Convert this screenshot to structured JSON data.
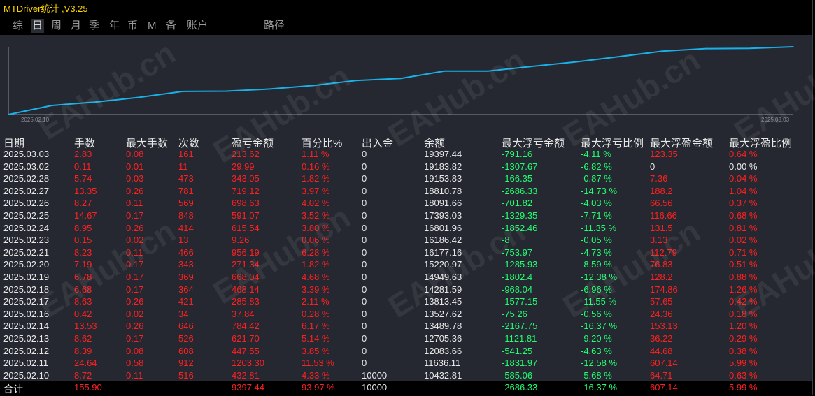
{
  "title": "MTDriver统计 ,V3.25",
  "tabs": [
    {
      "label": "综",
      "active": false
    },
    {
      "label": "日",
      "active": true
    },
    {
      "label": "周",
      "active": false
    },
    {
      "label": "月",
      "active": false
    },
    {
      "label": "季",
      "active": false
    },
    {
      "label": "年",
      "active": false
    },
    {
      "label": "币",
      "active": false
    },
    {
      "label": "M",
      "active": false
    },
    {
      "label": "备",
      "active": false
    },
    {
      "label": "账户",
      "active": false
    },
    {
      "label": "路径",
      "active": false
    }
  ],
  "watermark": "EAHub.cn",
  "chart_data": {
    "type": "line",
    "x_start_label": "2025.02.10",
    "x_end_label": "2025.03.03",
    "x": [
      "2025.02.10",
      "2025.02.11",
      "2025.02.12",
      "2025.02.13",
      "2025.02.14",
      "2025.02.16",
      "2025.02.17",
      "2025.02.18",
      "2025.02.19",
      "2025.02.20",
      "2025.02.21",
      "2025.02.23",
      "2025.02.24",
      "2025.02.25",
      "2025.02.26",
      "2025.02.27",
      "2025.02.28",
      "2025.03.02",
      "2025.03.03"
    ],
    "values": [
      10432.81,
      11636.11,
      12083.66,
      12705.36,
      13489.78,
      13527.62,
      13813.45,
      14281.59,
      14949.63,
      15220.97,
      16177.16,
      16186.42,
      16801.96,
      17393.03,
      18091.66,
      18810.78,
      19153.83,
      19183.82,
      19397.44
    ],
    "line_color": "#1ab0e8"
  },
  "table": {
    "headers": [
      "日期",
      "手数",
      "最大手数",
      "次数",
      "盈亏金额",
      "百分比%",
      "出入金",
      "余额",
      "最大浮亏金额",
      "最大浮亏比例",
      "最大浮盈金额",
      "最大浮盈比例"
    ],
    "rows": [
      [
        "2025.03.03",
        "2.83",
        "0.08",
        "161",
        "213.62",
        "1.11 %",
        "0",
        "19397.44",
        "-791.16",
        "-4.11 %",
        "123.35",
        "0.64 %"
      ],
      [
        "2025.03.02",
        "0.11",
        "0.01",
        "11",
        "29.99",
        "0.16 %",
        "0",
        "19183.82",
        "-1307.67",
        "-6.82 %",
        "0",
        "0.00 %"
      ],
      [
        "2025.02.28",
        "5.74",
        "0.03",
        "473",
        "343.05",
        "1.82 %",
        "0",
        "19153.83",
        "-166.35",
        "-0.87 %",
        "7.36",
        "0.04 %"
      ],
      [
        "2025.02.27",
        "13.35",
        "0.26",
        "781",
        "719.12",
        "3.97 %",
        "0",
        "18810.78",
        "-2686.33",
        "-14.73 %",
        "188.2",
        "1.04 %"
      ],
      [
        "2025.02.26",
        "8.27",
        "0.11",
        "569",
        "698.63",
        "4.02 %",
        "0",
        "18091.66",
        "-701.82",
        "-4.03 %",
        "66.56",
        "0.37 %"
      ],
      [
        "2025.02.25",
        "14.67",
        "0.17",
        "848",
        "591.07",
        "3.52 %",
        "0",
        "17393.03",
        "-1329.35",
        "-7.71 %",
        "116.66",
        "0.68 %"
      ],
      [
        "2025.02.24",
        "8.95",
        "0.26",
        "414",
        "615.54",
        "3.80 %",
        "0",
        "16801.96",
        "-1852.46",
        "-11.35 %",
        "131.5",
        "0.81 %"
      ],
      [
        "2025.02.23",
        "0.15",
        "0.02",
        "13",
        "9.26",
        "0.06 %",
        "0",
        "16186.42",
        "-8",
        "-0.05 %",
        "3.13",
        "0.02 %"
      ],
      [
        "2025.02.21",
        "8.23",
        "0.11",
        "466",
        "956.19",
        "6.28 %",
        "0",
        "16177.16",
        "-753.97",
        "-4.73 %",
        "112.79",
        "0.71 %"
      ],
      [
        "2025.02.20",
        "7.19",
        "0.17",
        "343",
        "271.34",
        "1.82 %",
        "0",
        "15220.97",
        "-1285.93",
        "-8.59 %",
        "76.83",
        "0.51 %"
      ],
      [
        "2025.02.19",
        "6.78",
        "0.17",
        "369",
        "668.04",
        "4.68 %",
        "0",
        "14949.63",
        "-1802.4",
        "-12.38 %",
        "128.2",
        "0.88 %"
      ],
      [
        "2025.02.18",
        "6.68",
        "0.17",
        "364",
        "468.14",
        "3.39 %",
        "0",
        "14281.59",
        "-968.04",
        "-6.96 %",
        "174.86",
        "1.26 %"
      ],
      [
        "2025.02.17",
        "8.63",
        "0.26",
        "421",
        "285.83",
        "2.11 %",
        "0",
        "13813.45",
        "-1577.15",
        "-11.55 %",
        "57.65",
        "0.42 %"
      ],
      [
        "2025.02.16",
        "0.42",
        "0.02",
        "34",
        "37.84",
        "0.28 %",
        "0",
        "13527.62",
        "-75.26",
        "-0.56 %",
        "24.36",
        "0.18 %"
      ],
      [
        "2025.02.14",
        "13.53",
        "0.26",
        "646",
        "784.42",
        "6.17 %",
        "0",
        "13489.78",
        "-2167.75",
        "-16.37 %",
        "153.13",
        "1.20 %"
      ],
      [
        "2025.02.13",
        "8.62",
        "0.17",
        "526",
        "621.70",
        "5.14 %",
        "0",
        "12705.36",
        "-1121.81",
        "-9.20 %",
        "36.22",
        "0.29 %"
      ],
      [
        "2025.02.12",
        "8.39",
        "0.08",
        "608",
        "447.55",
        "3.85 %",
        "0",
        "12083.66",
        "-541.25",
        "-4.63 %",
        "44.68",
        "0.38 %"
      ],
      [
        "2025.02.11",
        "24.64",
        "0.58",
        "912",
        "1203.30",
        "11.53 %",
        "0",
        "11636.11",
        "-1831.97",
        "-12.58 %",
        "607.14",
        "5.99 %"
      ],
      [
        "2025.02.10",
        "8.72",
        "0.11",
        "516",
        "432.81",
        "4.33 %",
        "10000",
        "10432.81",
        "-585.06",
        "-5.68 %",
        "64.71",
        "0.63 %"
      ]
    ],
    "total": [
      "合计",
      "155.90",
      "",
      "",
      "9397.44",
      "93.97 %",
      "10000",
      "",
      "-2686.33",
      "-16.37 %",
      "607.14",
      "5.99 %"
    ]
  },
  "colors": {
    "profit": "#ff2020",
    "loss": "#20ff70",
    "neutral": "#e8e8e8",
    "title": "#ffd700"
  }
}
